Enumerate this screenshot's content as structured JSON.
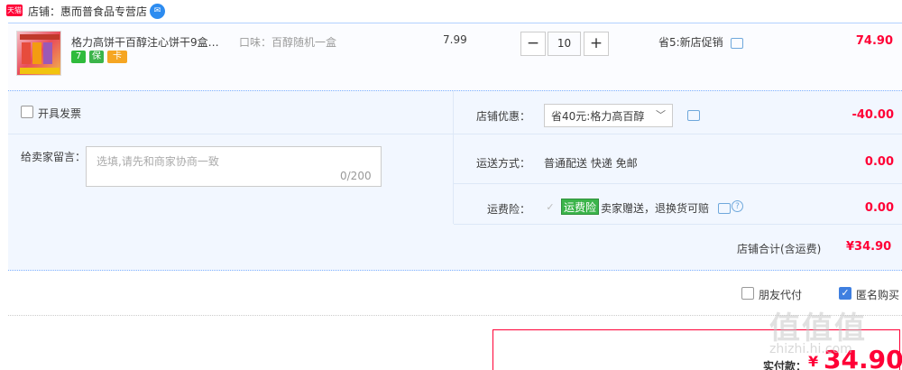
{
  "shop": {
    "badge": "天猫",
    "label": "店铺：惠而普食品专营店",
    "ww_icon": "wangwang-icon"
  },
  "item": {
    "title": "格力高饼干百醇注心饼干9盒百...",
    "sku": "口味：百醇随机一盒",
    "price": "7.99",
    "qty": "10",
    "minus": "−",
    "plus": "+",
    "promo": "省5:新店促销",
    "total": "74.90",
    "services": [
      "7",
      "保",
      "卡"
    ]
  },
  "invoice": {
    "label": "开具发票"
  },
  "message": {
    "label": "给卖家留言：",
    "placeholder": "选填,请先和商家协商一致",
    "count": "0/200"
  },
  "coupon": {
    "label": "店铺优惠：",
    "selected": "省40元:格力高百醇",
    "amount": "-40.00"
  },
  "shipping": {
    "label": "运送方式：",
    "text": "普通配送 快递 免邮",
    "amount": "0.00"
  },
  "insurance": {
    "label": "运费险：",
    "badge": "运费险",
    "text": "卖家赠送，退换货可赔",
    "amount": "0.00"
  },
  "subtotal": {
    "label": "店铺合计(含运费)",
    "amount": "¥34.90"
  },
  "options": {
    "friend_pay": "朋友代付",
    "anonymous": "匿名购买"
  },
  "payment": {
    "label": "实付款：",
    "yen": "¥",
    "amount": "34.90"
  },
  "watermark": {
    "glyphs": "值值值",
    "url": "zhizhi.hi.com"
  },
  "colors": {
    "accent": "#ff0036",
    "link": "#3f7fe0",
    "panel": "#f2f7ff"
  }
}
